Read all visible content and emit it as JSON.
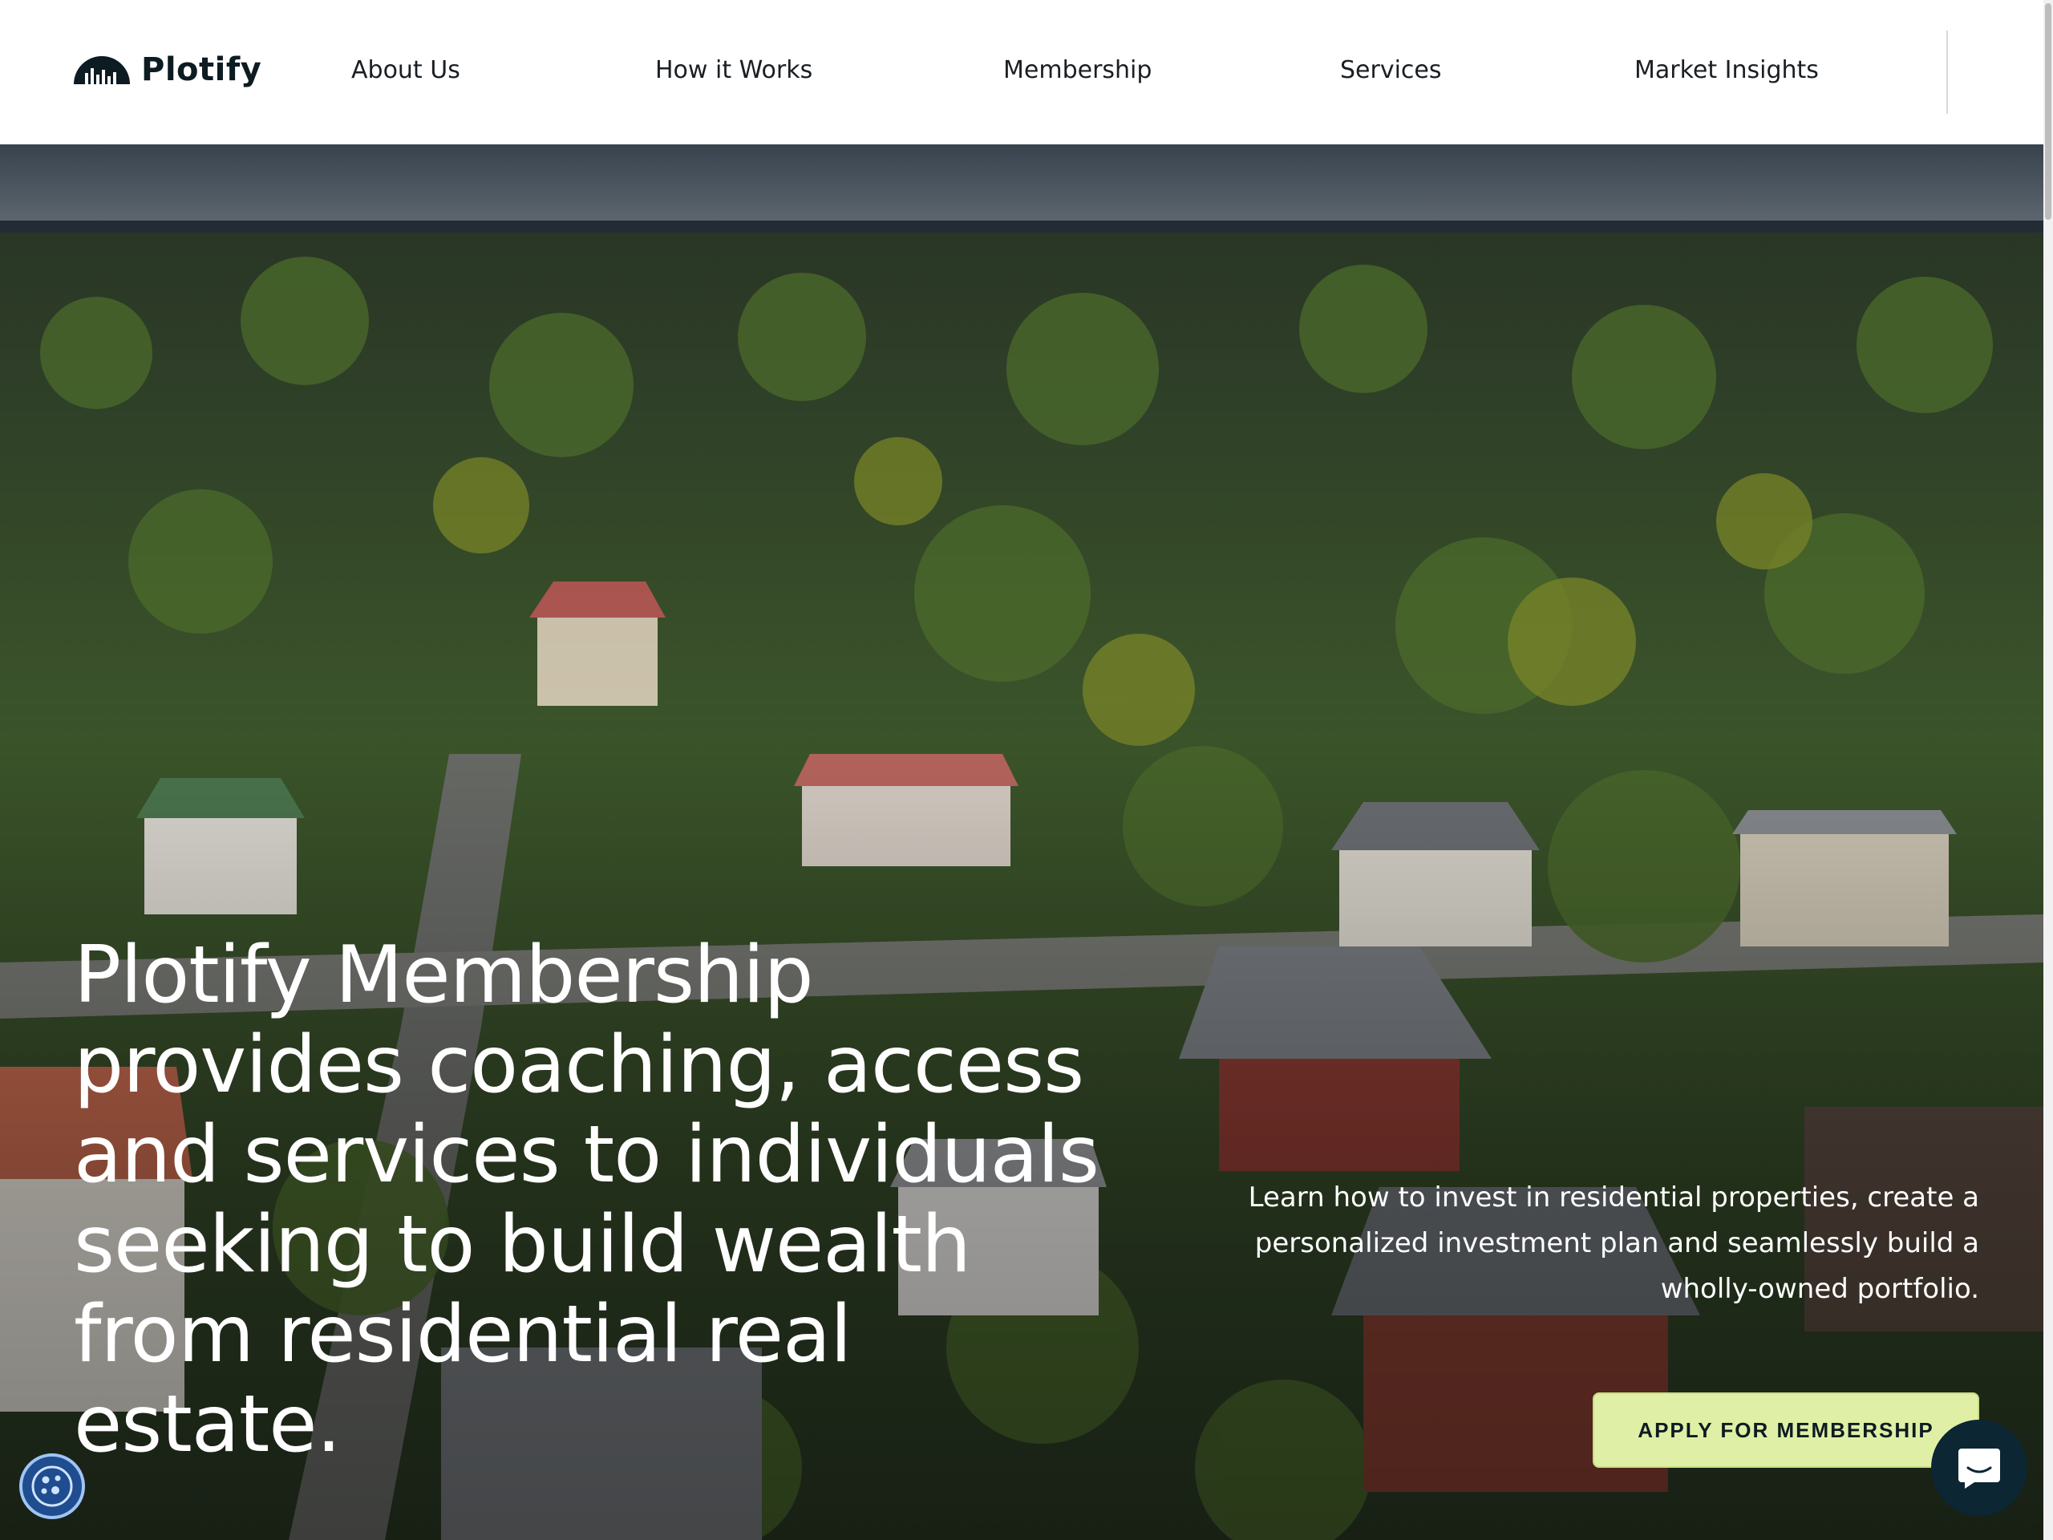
{
  "brand": {
    "name": "Plotify"
  },
  "nav": {
    "items": [
      {
        "label": "About Us"
      },
      {
        "label": "How it Works"
      },
      {
        "label": "Membership"
      },
      {
        "label": "Services"
      },
      {
        "label": "Market Insights"
      }
    ]
  },
  "hero": {
    "headline": "Plotify Membership provides coaching, access and services to individuals seeking to build wealth from residential real estate.",
    "subtext": "Learn how to invest in residential properties, create a personalized investment plan and seamlessly build a wholly-owned portfolio.",
    "cta_label": "APPLY FOR MEMBERSHIP",
    "background_image": "aerial-suburban-neighborhood-photo"
  },
  "widgets": {
    "cookie_icon": "cookie-settings-icon",
    "chat_icon": "chat-bubble-icon"
  },
  "colors": {
    "cta_background": "#dff0a6",
    "chat_background": "#0c2633",
    "cookie_background": "#1f4d8f",
    "text_dark": "#0d1b22"
  }
}
